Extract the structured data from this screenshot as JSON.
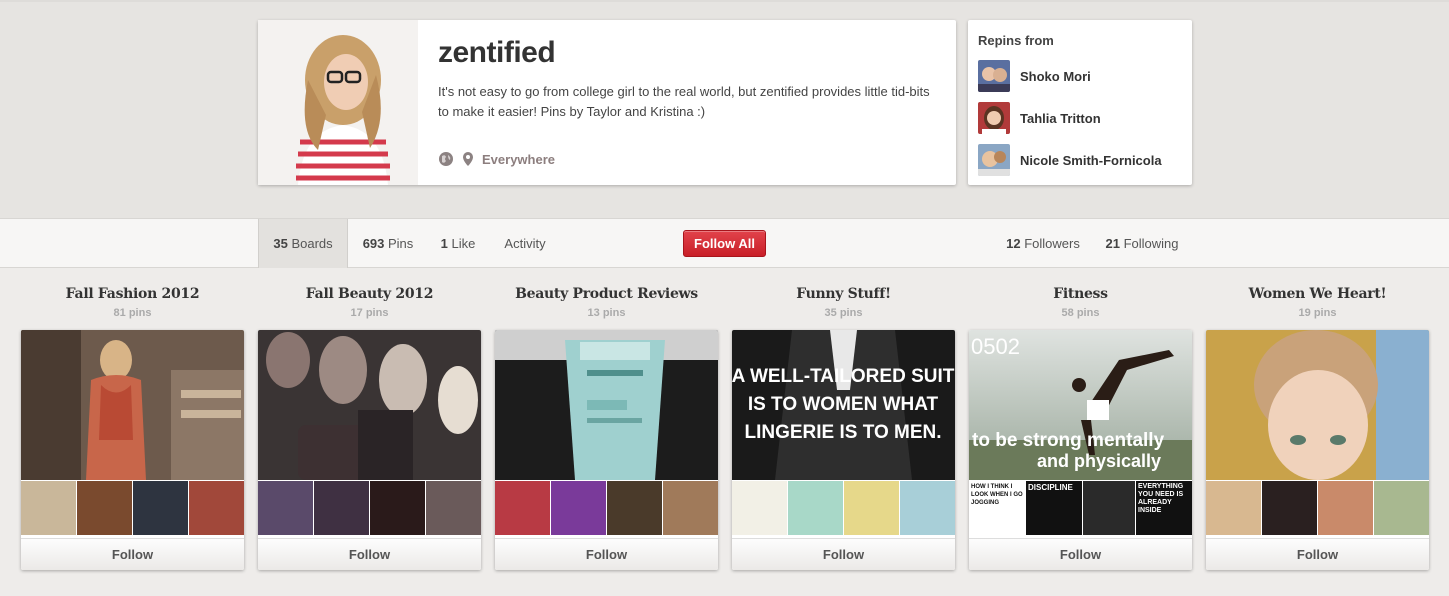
{
  "profile": {
    "name": "zentified",
    "bio": "It's not easy to go from college girl to the real world, but zentified provides little tid-bits to make it easier! Pins by Taylor and Kristina :)",
    "location": "Everywhere",
    "icons": [
      "globe-icon",
      "location-pin-icon"
    ]
  },
  "repins": {
    "title": "Repins from",
    "users": [
      {
        "name": "Shoko Mori"
      },
      {
        "name": "Tahlia Tritton"
      },
      {
        "name": "Nicole Smith-Fornicola"
      }
    ]
  },
  "nav": {
    "boards_count": "35",
    "boards_label": " Boards",
    "pins_count": "693",
    "pins_label": " Pins",
    "likes_count": "1",
    "likes_label": " Like",
    "activity_label": "Activity",
    "follow_all_label": "Follow All",
    "followers_count": "12",
    "followers_label": " Followers",
    "following_count": "21",
    "following_label": " Following"
  },
  "boards": [
    {
      "title": "Fall Fashion 2012",
      "count": "81 pins",
      "follow": "Follow"
    },
    {
      "title": "Fall Beauty 2012",
      "count": "17 pins",
      "follow": "Follow"
    },
    {
      "title": "Beauty Product Reviews",
      "count": "13 pins",
      "follow": "Follow"
    },
    {
      "title": "Funny Stuff!",
      "count": "35 pins",
      "follow": "Follow",
      "cover_text": [
        "A WELL-TAILORED SUIT",
        "IS TO WOMEN WHAT",
        "LINGERIE IS TO MEN."
      ]
    },
    {
      "title": "Fitness",
      "count": "58 pins",
      "follow": "Follow",
      "cover_text": [
        "0502",
        "to be strong mentally",
        "and physically"
      ],
      "thumb_text": [
        "HOW I THINK I LOOK WHEN I GO JOGGING",
        "DISCIPLINE",
        "EVERYTHING YOU NEED IS ALREADY INSIDE"
      ]
    },
    {
      "title": "Women We Heart!",
      "count": "19 pins",
      "follow": "Follow"
    }
  ],
  "colors": {
    "accent_red": "#d02a32",
    "background": "#eeecea",
    "nav_background": "#f7f6f5"
  }
}
